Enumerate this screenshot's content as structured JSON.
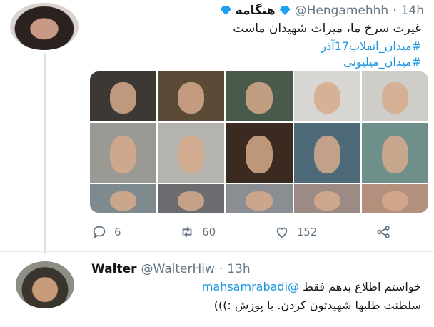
{
  "tweet": {
    "name": "هنگامه",
    "handle": "@Hengamehhh",
    "separator": "·",
    "time": "14h",
    "text": "غیرت سرخ ما، میراث شهیدان ماست",
    "hashtags": [
      "#میدان_انقلاب17آذر",
      "#میدان_میلیونی"
    ],
    "actions": {
      "reply_count": "6",
      "retweet_count": "60",
      "like_count": "152"
    }
  },
  "reply": {
    "name": "Walter",
    "handle": "@WalterHiw",
    "separator": "·",
    "time": "13h",
    "mention": "@mahsamrabadi",
    "line1": "خواستم اطلاع بدهم فقط",
    "line2": "سلطنت طلبها شهیدتون کردن. با پوزش :)))"
  },
  "colors": {
    "link": "#1b95e0",
    "muted": "#657786",
    "verified": "#1da1f2"
  }
}
